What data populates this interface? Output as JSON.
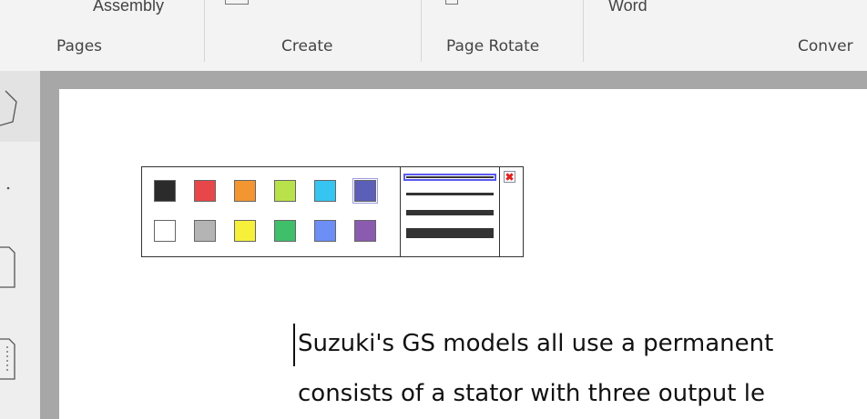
{
  "ribbon": {
    "top_labels": {
      "assembly": "Assembly",
      "word": "Word"
    },
    "groups": [
      "Pages",
      "Create",
      "Page Rotate",
      "Conver"
    ]
  },
  "picker": {
    "colors": {
      "row1": [
        "#2b2b2b",
        "#e8474a",
        "#f39632",
        "#b9e24a",
        "#36c5f0",
        "#5c5fb7"
      ],
      "row2": [
        "#ffffff",
        "#b4b4b4",
        "#f7f03a",
        "#3fbf6a",
        "#6c8ef5",
        "#8b5bb0"
      ]
    },
    "selected_color": "#5c5fb7",
    "stroke_widths": [
      "thin",
      "medium",
      "thick",
      "extra-thick"
    ],
    "selected_stroke": "thin"
  },
  "document": {
    "lines": [
      "Suzuki's GS models all use a permanent",
      "consists of a stator with three output le"
    ]
  }
}
